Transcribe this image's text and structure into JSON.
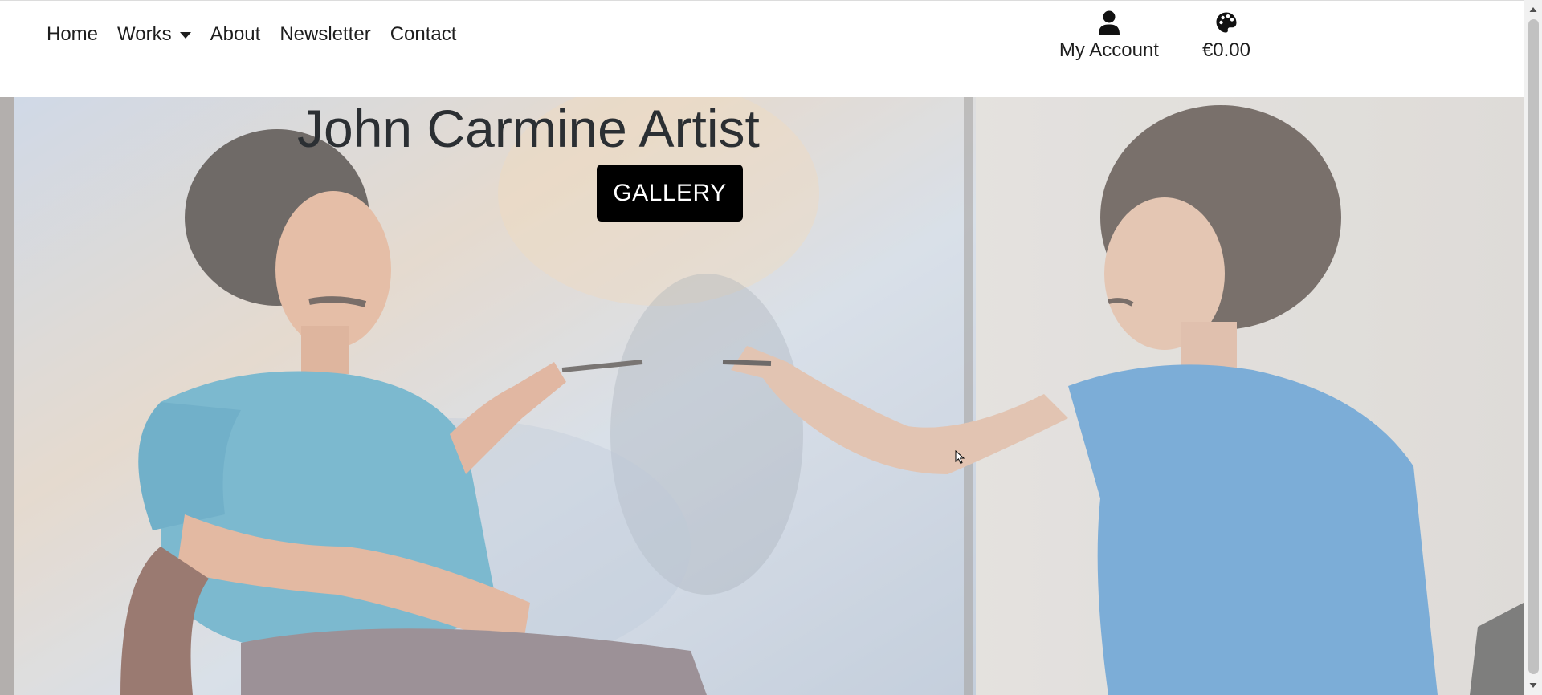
{
  "nav": {
    "links": [
      {
        "label": "Home"
      },
      {
        "label": "Works",
        "has_dropdown": true
      },
      {
        "label": "About"
      },
      {
        "label": "Newsletter"
      },
      {
        "label": "Contact"
      }
    ],
    "account": {
      "label": "My Account",
      "icon": "user-icon"
    },
    "cart": {
      "label": "€0.00",
      "icon": "palette-icon"
    }
  },
  "hero": {
    "title": "John Carmine Artist",
    "button_label": "GALLERY",
    "background": "painting-and-painter-photo"
  },
  "colors": {
    "button_bg": "#000000",
    "button_text": "#ffffff",
    "title_text": "#2b2f33",
    "shirt_blue": "#3f86c4"
  }
}
